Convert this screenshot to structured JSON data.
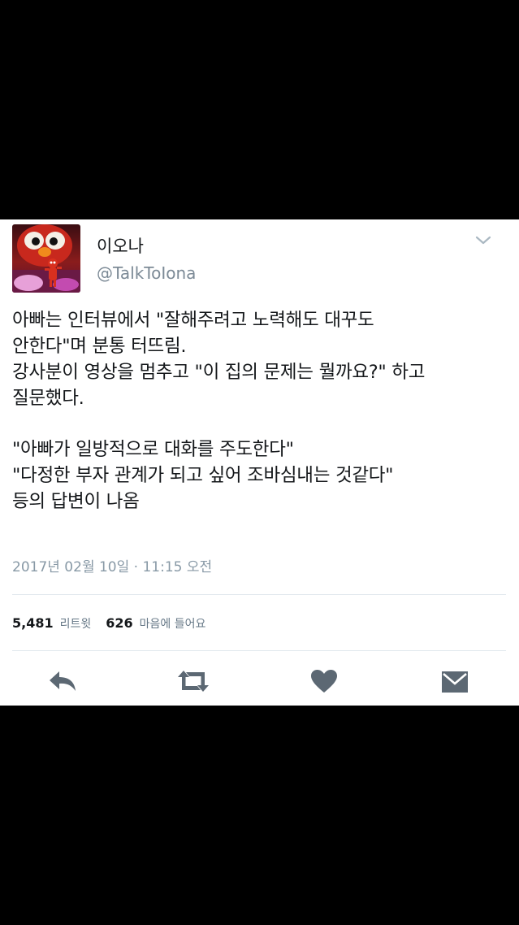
{
  "user": {
    "display_name": "이오나",
    "handle": "@TalkToIona",
    "avatar_icon": "elmo-avatar-icon"
  },
  "tweet": {
    "lines": [
      "아빠는 인터뷰에서 \"잘해주려고 노력해도 대꾸도",
      "안한다\"며 분통 터뜨림.",
      "강사분이 영상을 멈추고 \"이 집의 문제는 뭘까요?\" 하고",
      "질문했다.",
      "",
      "\"아빠가 일방적으로 대화를 주도한다\"",
      "\"다정한 부자 관계가 되고 싶어 조바심내는 것같다\"",
      "등의 답변이 나옴"
    ],
    "timestamp": "2017년 02월 10일 · 11:15 오전"
  },
  "stats": {
    "retweets_count": "5,481",
    "retweets_label": "리트윗",
    "likes_count": "626",
    "likes_label": "마음에 들어요"
  },
  "actions": [
    {
      "name": "reply",
      "icon": "reply-icon"
    },
    {
      "name": "retweet",
      "icon": "retweet-icon"
    },
    {
      "name": "like",
      "icon": "heart-icon"
    },
    {
      "name": "direct-message",
      "icon": "envelope-icon"
    }
  ],
  "colors": {
    "icon_gray": "#5c6873",
    "text_dark": "#14171a",
    "text_muted": "#7c8a96"
  }
}
